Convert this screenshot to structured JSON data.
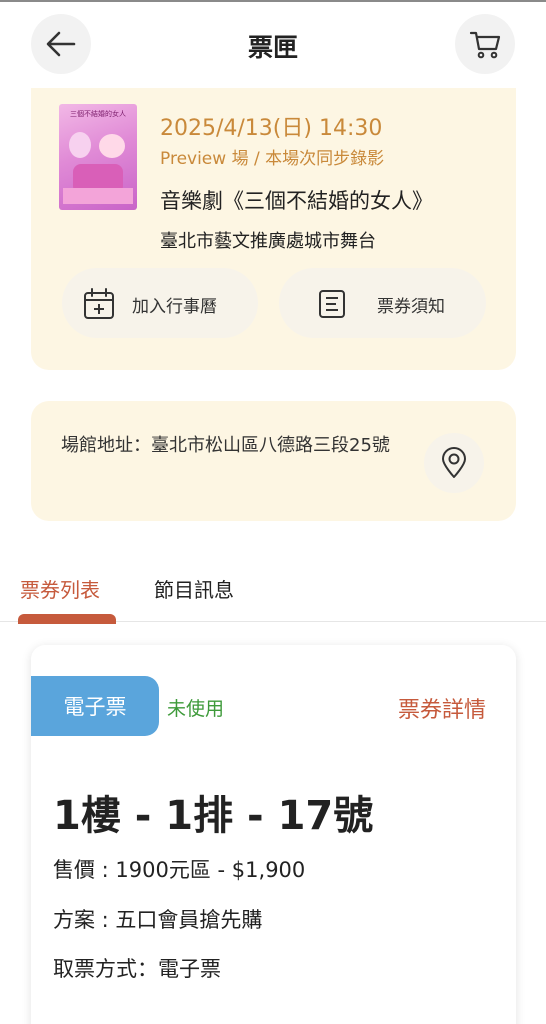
{
  "header": {
    "title": "票匣",
    "back_icon": "arrow-left-icon",
    "cart_icon": "cart-icon"
  },
  "event": {
    "poster_text": "三個不結婚的女人",
    "date_time": "2025/4/13(日) 14:30",
    "session_note": "Preview 場 / 本場次同步錄影",
    "name": "音樂劇《三個不結婚的女人》",
    "venue": "臺北市藝文推廣處城市舞台",
    "add_calendar_label": "加入行事曆",
    "ticket_notice_label": "票券須知"
  },
  "address": {
    "text": "場館地址：臺北市松山區八德路三段25號"
  },
  "tabs": [
    {
      "label": "票券列表",
      "active": true
    },
    {
      "label": "節目訊息",
      "active": false
    }
  ],
  "ticket": {
    "type_badge": "電子票",
    "status": "未使用",
    "detail_link": "票券詳情",
    "seat": "1樓 - 1排 - 17號",
    "price_line": "售價 : 1900元區 - $1,900",
    "plan_line": "方案 : 五口會員搶先購",
    "pickup_line": "取票方式：電子票"
  },
  "colors": {
    "accent": "#c65a3c",
    "gold": "#c9893a",
    "card_bg": "#fdf6e3",
    "badge_blue": "#5aa5dc",
    "status_green": "#3e9a3a"
  }
}
